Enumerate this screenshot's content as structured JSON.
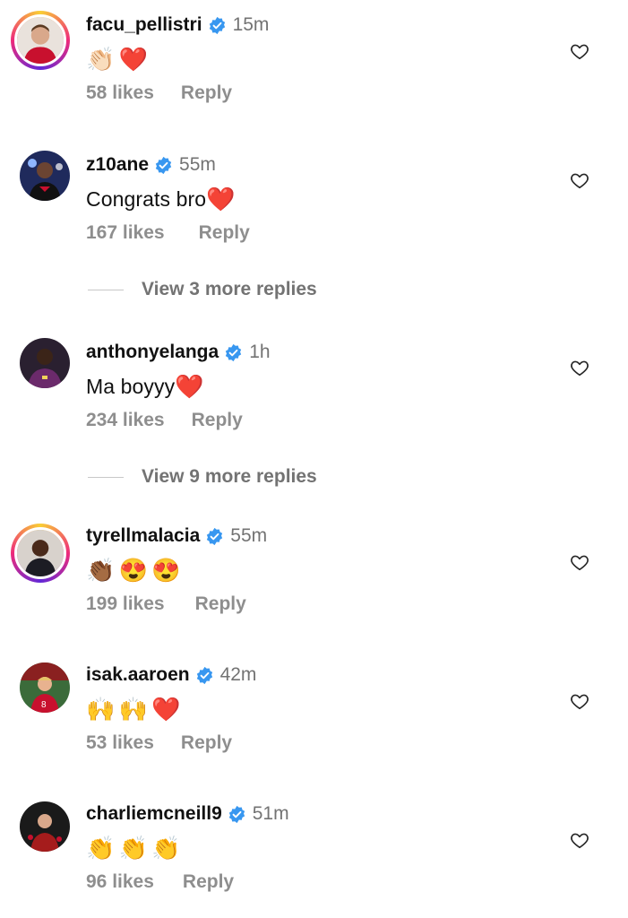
{
  "comments": [
    {
      "username": "facu_pellistri",
      "time": "15m",
      "text": "",
      "emojis": [
        "👏🏻",
        "❤️"
      ],
      "likes": "58 likes",
      "reply": "Reply",
      "ring": true,
      "avatar_color": "#c8102e"
    },
    {
      "username": "z10ane",
      "time": "55m",
      "text": "Congrats bro",
      "emojis": [
        "❤️"
      ],
      "likes": "167 likes",
      "reply": "Reply",
      "ring": false,
      "avatar_color": "#2b2f6b"
    },
    {
      "username": "anthonyelanga",
      "time": "1h",
      "text": "Ma boyyy",
      "emojis": [
        "❤️"
      ],
      "likes": "234 likes",
      "reply": "Reply",
      "ring": false,
      "avatar_color": "#6b2a6b"
    },
    {
      "username": "tyrellmalacia",
      "time": "55m",
      "text": "",
      "emojis": [
        "👏🏾",
        "😍",
        "😍"
      ],
      "likes": "199 likes",
      "reply": "Reply",
      "ring": true,
      "avatar_color": "#3a2a20"
    },
    {
      "username": "isak.aaroen",
      "time": "42m",
      "text": "",
      "emojis": [
        "🙌",
        "🙌",
        "❤️"
      ],
      "likes": "53 likes",
      "reply": "Reply",
      "ring": false,
      "avatar_color": "#b51d22"
    },
    {
      "username": "charliemcneill9",
      "time": "51m",
      "text": "",
      "emojis": [
        "👏",
        "👏",
        "👏"
      ],
      "likes": "96 likes",
      "reply": "Reply",
      "ring": false,
      "avatar_color": "#7a1b1b"
    }
  ],
  "view_more": [
    {
      "label": "View 3 more replies"
    },
    {
      "label": "View 9 more replies"
    }
  ],
  "colors": {
    "verified": "#3897f0",
    "muted": "#8e8e8e"
  }
}
